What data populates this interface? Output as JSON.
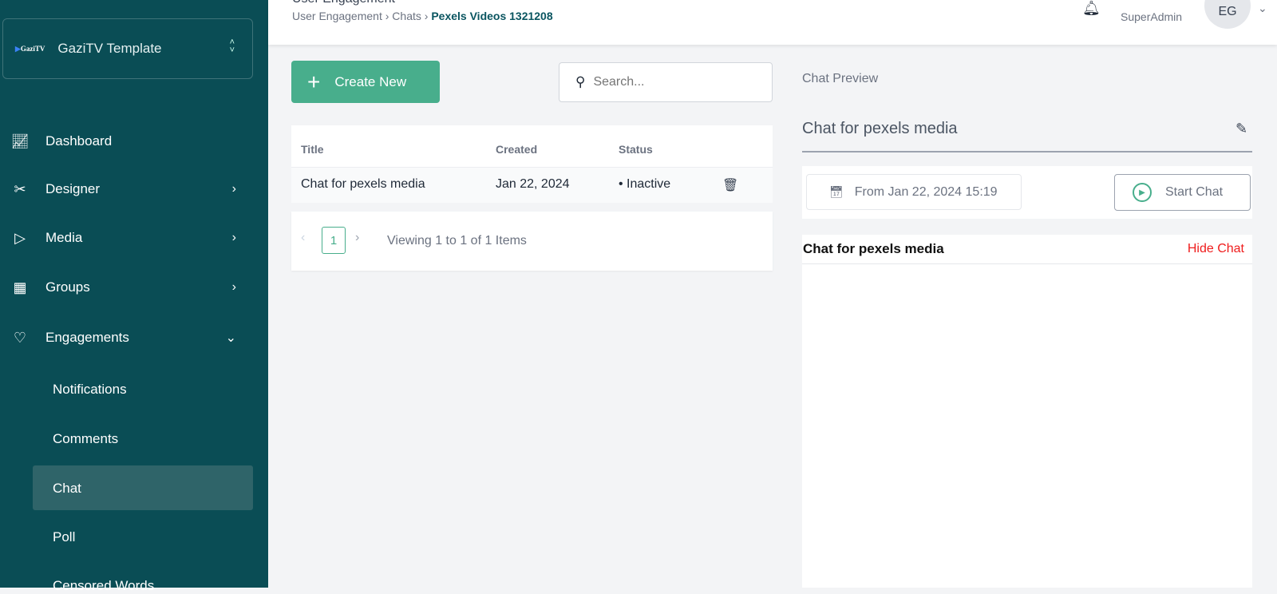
{
  "sidebar": {
    "logo_text": "GaziTV",
    "org_name": "GaziTV Template",
    "items": [
      {
        "label": "Dashboard",
        "icon": "chart-line-icon"
      },
      {
        "label": "Designer",
        "icon": "tools-icon"
      },
      {
        "label": "Media",
        "icon": "play-icon"
      },
      {
        "label": "Groups",
        "icon": "grid-icon"
      },
      {
        "label": "Engagements",
        "icon": "heart-icon"
      }
    ],
    "subitems": [
      "Notifications",
      "Comments",
      "Chat",
      "Poll",
      "Censored Words"
    ],
    "active": "Chat"
  },
  "header": {
    "title": "User Engagement",
    "breadcrumb": [
      "User Engagement",
      "Chats",
      "Pexels Videos 1321208"
    ],
    "role": "SuperAdmin",
    "avatar": "EG"
  },
  "toolbar": {
    "create_label": "Create New",
    "search_placeholder": "Search..."
  },
  "table": {
    "columns": [
      "Title",
      "Created",
      "Status"
    ],
    "rows": [
      {
        "title": "Chat for pexels media",
        "created": "Jan 22, 2024",
        "status": "Inactive"
      }
    ]
  },
  "pagination": {
    "page": "1",
    "summary": "Viewing 1 to 1 of 1 Items"
  },
  "preview": {
    "label": "Chat Preview",
    "title": "Chat for pexels media",
    "date": "From Jan 22, 2024 15:19",
    "start_label": "Start Chat",
    "chat_title": "Chat for pexels media",
    "hide_label": "Hide Chat"
  },
  "colors": {
    "sidebar": "#0a4d55",
    "accent": "#48ae8c",
    "danger": "#ef1c1c"
  }
}
